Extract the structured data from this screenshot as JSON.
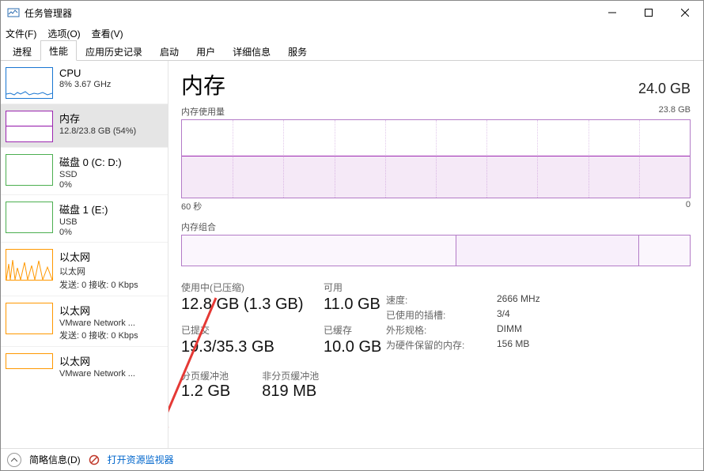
{
  "window": {
    "title": "任务管理器"
  },
  "menu": {
    "file": "文件(F)",
    "options": "选项(O)",
    "view": "查看(V)"
  },
  "tabs": [
    "进程",
    "性能",
    "应用历史记录",
    "启动",
    "用户",
    "详细信息",
    "服务"
  ],
  "sidebar": {
    "items": [
      {
        "title": "CPU",
        "sub": "8% 3.67 GHz"
      },
      {
        "title": "内存",
        "sub": "12.8/23.8 GB (54%)"
      },
      {
        "title": "磁盘 0 (C: D:)",
        "sub": "SSD",
        "sub2": "0%"
      },
      {
        "title": "磁盘 1 (E:)",
        "sub": "USB",
        "sub2": "0%"
      },
      {
        "title": "以太网",
        "sub": "以太网",
        "sub2": "发送: 0 接收: 0 Kbps"
      },
      {
        "title": "以太网",
        "sub": "VMware Network ...",
        "sub2": "发送: 0 接收: 0 Kbps"
      },
      {
        "title": "以太网",
        "sub": "VMware Network ..."
      }
    ]
  },
  "content": {
    "title": "内存",
    "total": "24.0 GB",
    "graph1_label": "内存使用量",
    "graph1_max": "23.8 GB",
    "axis_left": "60 秒",
    "axis_right": "0",
    "comp_label": "内存组合",
    "stats": {
      "in_use_label": "使用中(已压缩)",
      "in_use_value": "12.8 GB (1.3 GB)",
      "avail_label": "可用",
      "avail_value": "11.0 GB",
      "committed_label": "已提交",
      "committed_value": "19.3/35.3 GB",
      "cached_label": "已缓存",
      "cached_value": "10.0 GB",
      "paged_label": "分页缓冲池",
      "paged_value": "1.2 GB",
      "nonpaged_label": "非分页缓冲池",
      "nonpaged_value": "819 MB"
    },
    "specs": {
      "speed_label": "速度:",
      "speed_value": "2666 MHz",
      "slots_label": "已使用的插槽:",
      "slots_value": "3/4",
      "form_label": "外形规格:",
      "form_value": "DIMM",
      "reserved_label": "为硬件保留的内存:",
      "reserved_value": "156 MB"
    }
  },
  "bottom": {
    "brief": "简略信息(D)",
    "resmon": "打开资源监视器"
  }
}
